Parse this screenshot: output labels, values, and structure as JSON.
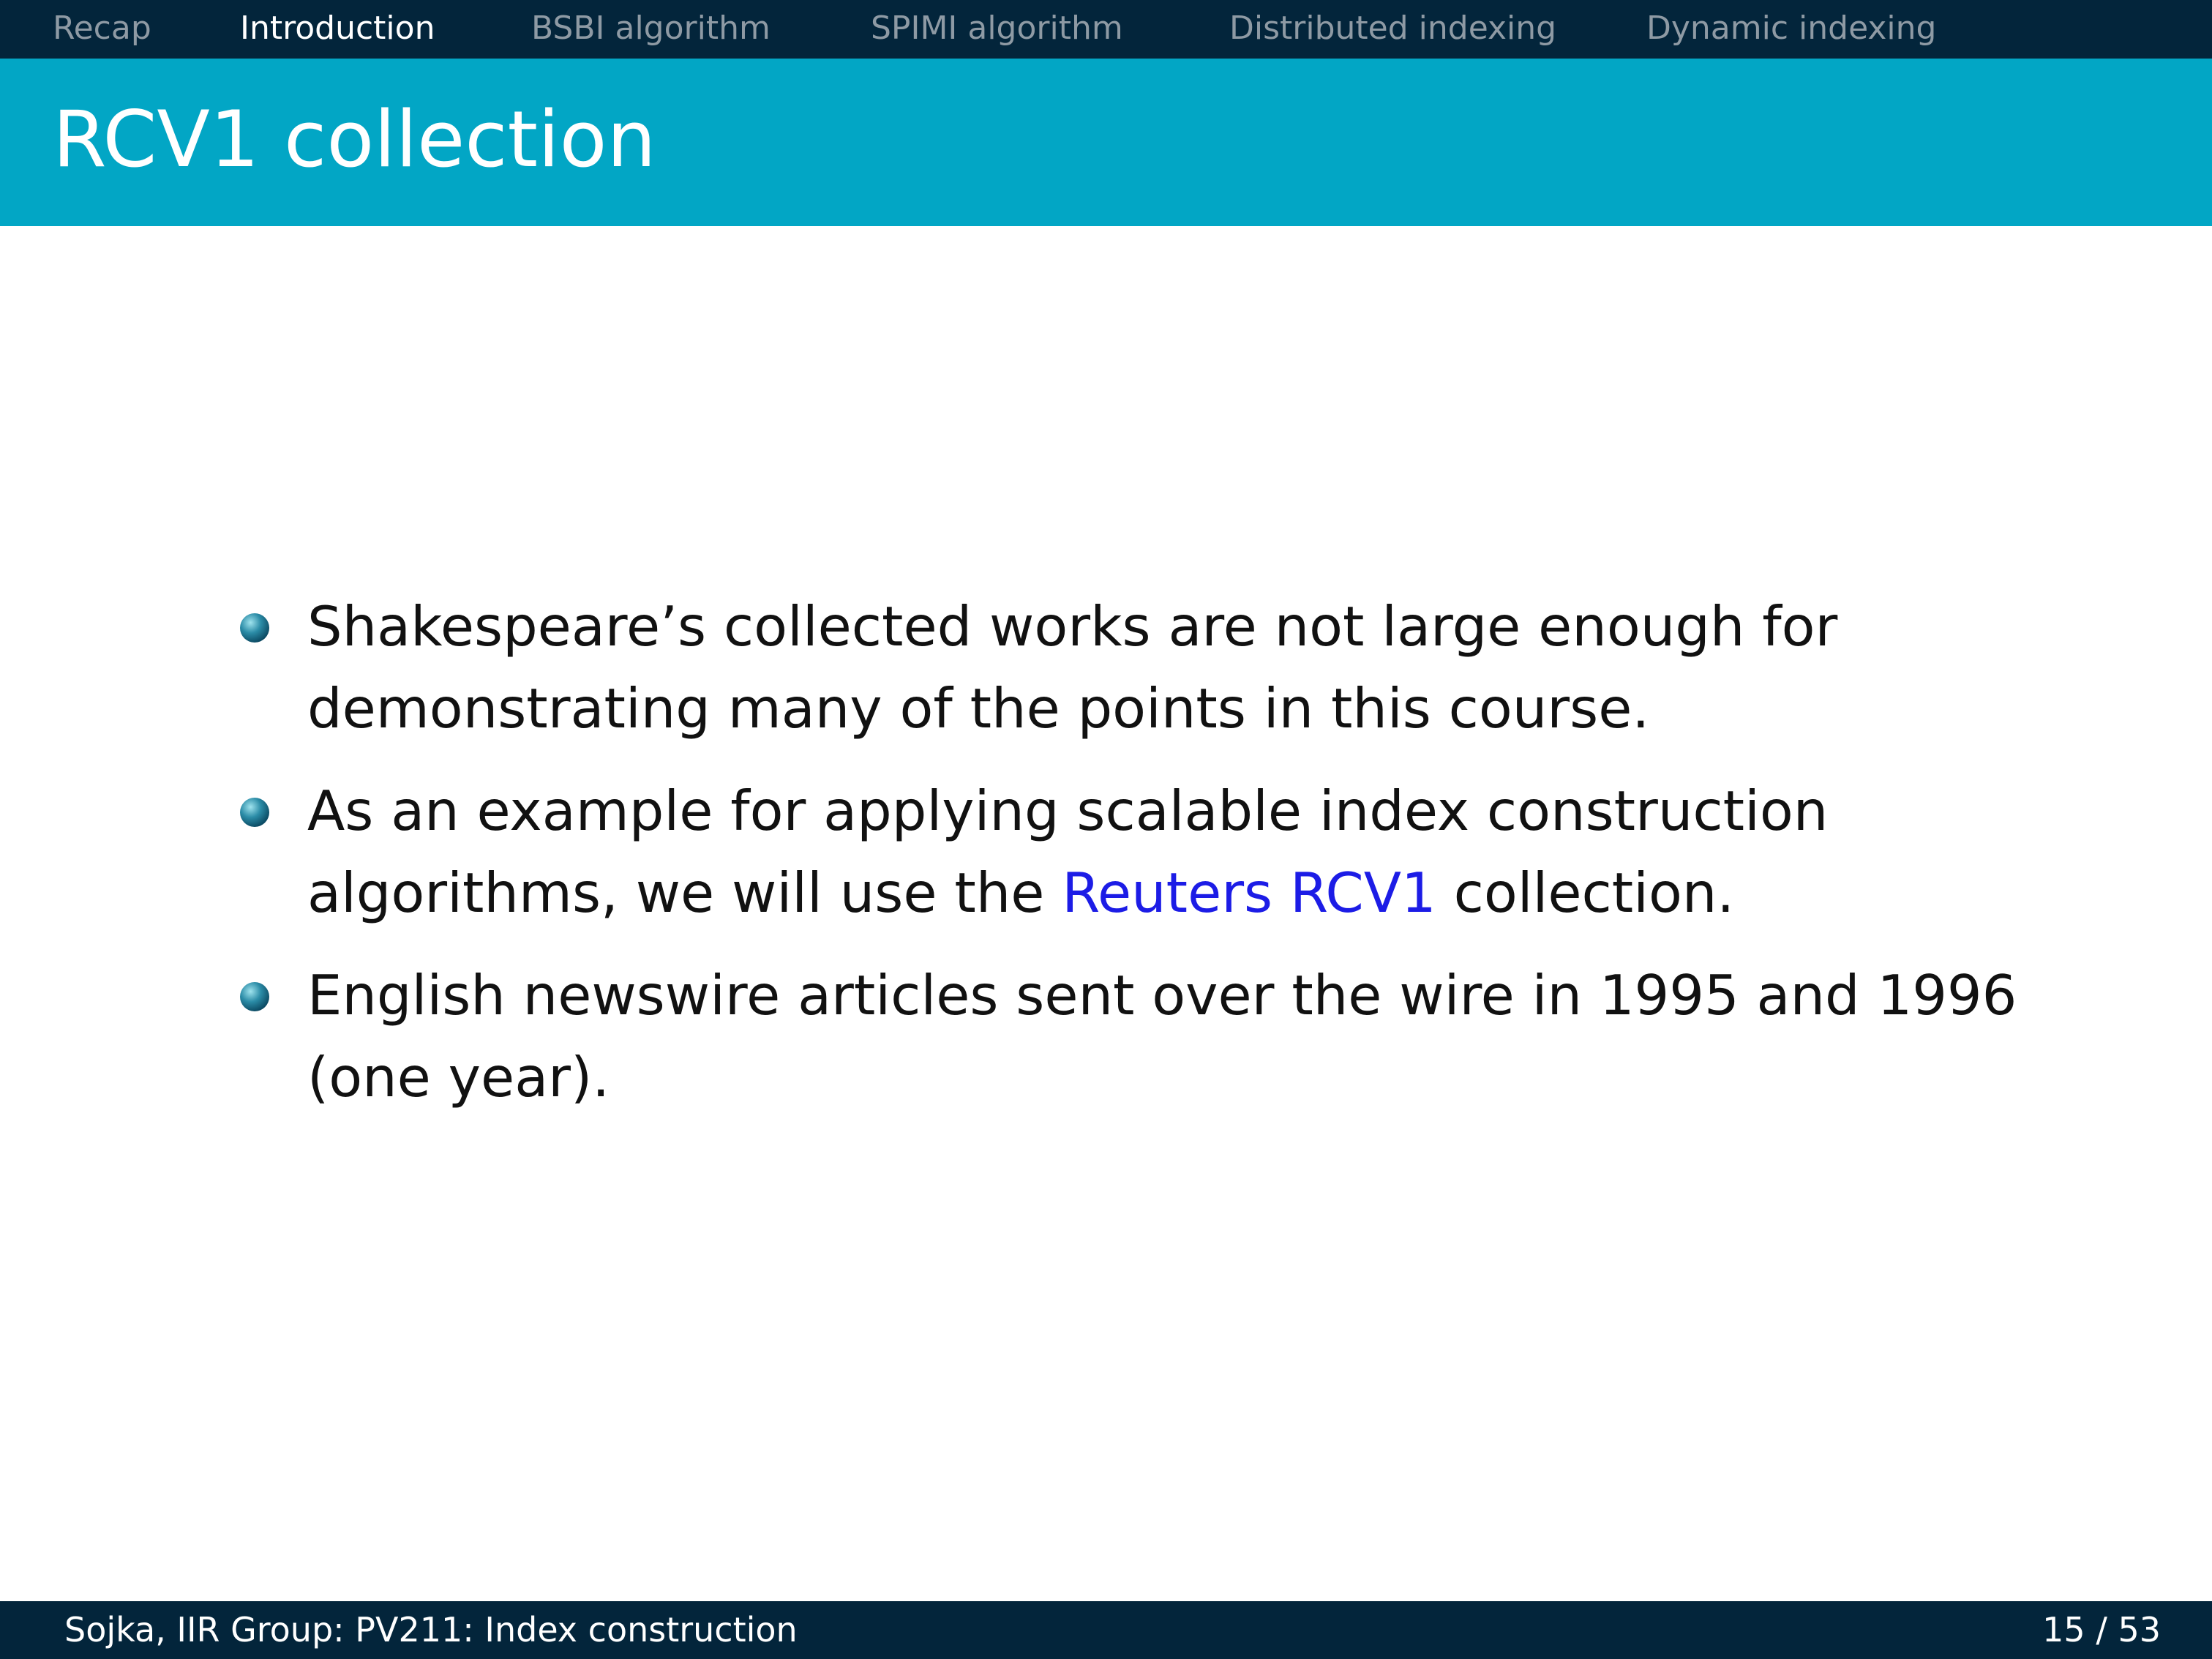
{
  "nav": {
    "items": [
      {
        "label": "Recap",
        "active": false
      },
      {
        "label": "Introduction",
        "active": true
      },
      {
        "label": "BSBI algorithm",
        "active": false
      },
      {
        "label": "SPIMI algorithm",
        "active": false
      },
      {
        "label": "Distributed indexing",
        "active": false
      },
      {
        "label": "Dynamic indexing",
        "active": false
      }
    ]
  },
  "slide": {
    "title": "RCV1 collection",
    "bullets": [
      {
        "text": "Shakespeare’s collected works are not large enough for demonstrating many of the points in this course."
      },
      {
        "before": "As an example for applying scalable index construction algorithms, we will use the ",
        "link": "Reuters RCV1",
        "after": " collection."
      },
      {
        "text": "English newswire articles sent over the wire in 1995 and 1996 (one year)."
      }
    ]
  },
  "footer": {
    "left": "Sojka, IIR Group: PV211: Index construction",
    "page_current": "15",
    "page_separator": " / ",
    "page_total": "53"
  },
  "colors": {
    "nav_background": "#03253b",
    "title_bar": "#02a6c5",
    "link": "#1c1ce6",
    "nav_inactive_text": "#8e9aa4"
  }
}
